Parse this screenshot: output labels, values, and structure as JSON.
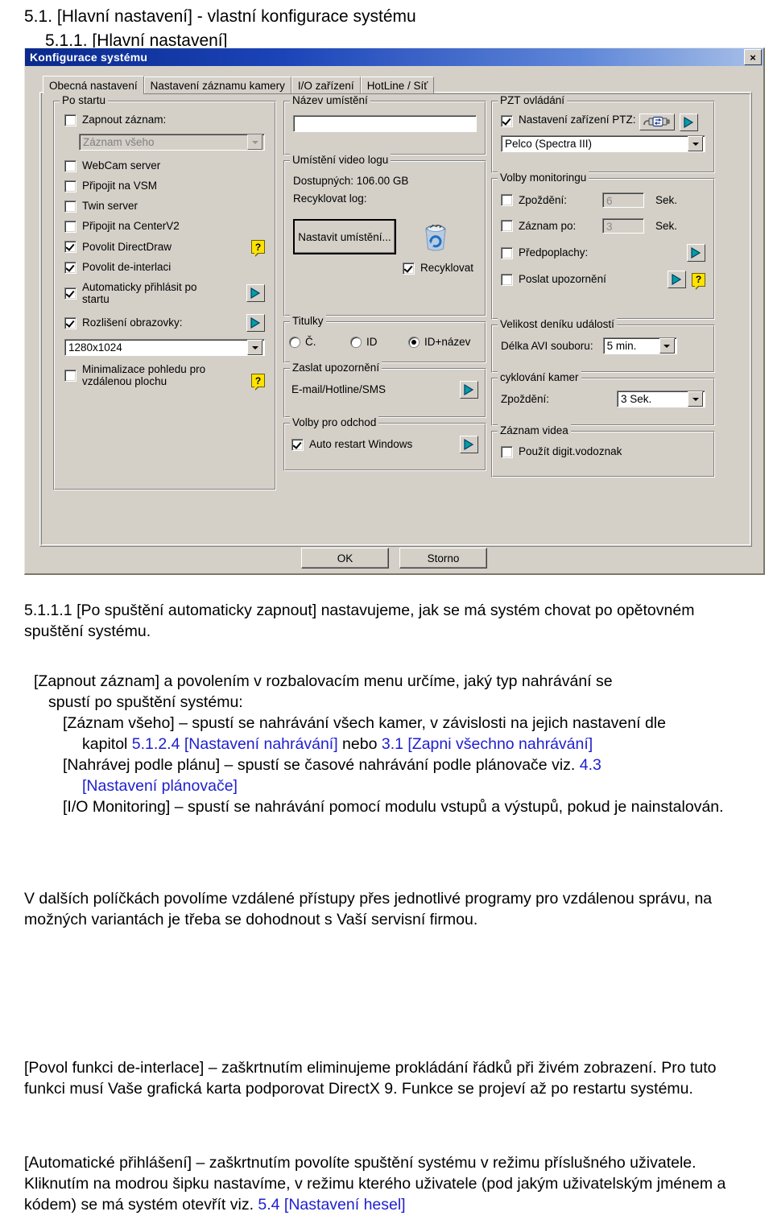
{
  "document": {
    "heading1": "5.1. [Hlavní nastavení] - vlastní konfigurace systému",
    "heading2": "5.1.1. [Hlavní nastavení]"
  },
  "dialog": {
    "title": "Konfigurace systému",
    "close_icon": "×",
    "tabs": [
      {
        "label": "Obecná nastavení",
        "active": true
      },
      {
        "label": "Nastavení záznamu kamery",
        "active": false
      },
      {
        "label": "I/O zařízení",
        "active": false
      },
      {
        "label": "HotLine / Síť",
        "active": false
      }
    ],
    "groups": {
      "po_startu": {
        "title": "Po startu",
        "zapnout_zaznam": "Zapnout záznam:",
        "zaznam_combo_value": "Záznam všeho",
        "webcam": "WebCam server",
        "vsm": "Připojit na VSM",
        "twin": "Twin server",
        "centerv2": "Připojit na CenterV2",
        "directdraw": "Povolit DirectDraw",
        "deinterlace": "Povolit de-interlaci",
        "autologin": "Automaticky přihlásit po startu",
        "resolution_label": "Rozlišení obrazovky:",
        "resolution_value": "1280x1024",
        "minimize": "Minimalizace pohledu pro vzdálenou plochu",
        "help_glyph": "?"
      },
      "nazev_umisteni": {
        "title": "Název umístění",
        "value": ""
      },
      "umisteni_video_logu": {
        "title": "Umístění video logu",
        "available": "Dostupných: 106.00 GB",
        "recycle_log": "Recyklovat log:",
        "set_location_button": "Nastavit umístění...",
        "recycle_checkbox": "Recyklovat",
        "bin_icon": "recycle-bin-icon"
      },
      "titulky": {
        "title": "Titulky",
        "options": [
          "Č.",
          "ID",
          "ID+název"
        ],
        "selected": "ID+název"
      },
      "zaslat_upozorneni": {
        "title": "Zaslat upozornění",
        "label": "E-mail/Hotline/SMS"
      },
      "volby_pro_odchod": {
        "title": "Volby pro odchod",
        "auto_restart": "Auto restart Windows"
      },
      "pzt_ovladani": {
        "title": "PZT ovládání",
        "device_label": "Nastavení zařízení PTZ:",
        "device_value": "Pelco (Spectra III)"
      },
      "volby_monitoringu": {
        "title": "Volby monitoringu",
        "zpozdeni_label": "Zpoždění:",
        "zpozdeni_value": "6",
        "zpozdeni_unit": "Sek.",
        "zaznam_po_label": "Záznam po:",
        "zaznam_po_value": "3",
        "zaznam_po_unit": "Sek.",
        "predpoplachy": "Předpoplachy:",
        "poslat_upozorneni": "Poslat upozornění"
      },
      "velikost_deniku": {
        "title": "Velikost deníku událostí",
        "avi_label": "Délka AVI souboru:",
        "avi_value": "5 min."
      },
      "cyklovani_kamer": {
        "title": "cyklování kamer",
        "zpozdeni_label": "Zpoždění:",
        "zpozdeni_value": "3 Sek."
      },
      "zaznam_videa": {
        "title": "Záznam videa",
        "watermark": "Použít digit.vodoznak"
      }
    },
    "buttons": {
      "ok": "OK",
      "cancel": "Storno"
    }
  },
  "text": {
    "para1_num": "5.1.1.1",
    "para1": "[Po spuštění automaticky zapnout] nastavujeme, jak se má systém chovat po opětovném spuštění systému.",
    "para2_line1": "[Zapnout záznam] a povolením v rozbalovacím menu určíme, jaký typ nahrávání se",
    "para2_line2": "spustí po spuštění systému:",
    "para2_line3a": "[Záznam všeho] – spustí se nahrávání všech kamer, v závislosti na jejich nastavení dle",
    "para2_line3b_pre": "kapitol ",
    "para2_link1": "5.1.2.4 [Nastavení nahrávání]",
    "para2_line3b_mid": " nebo ",
    "para2_link2": "3.1 [Zapni všechno nahrávání]",
    "para2_line4_pre": "[Nahrávej podle plánu] – spustí se časové nahrávání podle plánovače viz. ",
    "para2_link3": "4.3",
    "para2_link4": "[Nastavení plánovače]",
    "para2_line5": "[I/O Monitoring] – spustí se nahrávání pomocí modulu vstupů a výstupů, pokud je nainstalován.",
    "para3": "V dalších políčkách povolíme vzdálené přístupy přes jednotlivé programy pro vzdálenou správu, na možných variantách je třeba se dohodnout s Vaší servisní firmou.",
    "para4": "[Povol funkci de-interlace] – zaškrtnutím eliminujeme prokládání řádků při živém zobrazení. Pro tuto funkci musí Vaše grafická karta podporovat DirectX 9. Funkce se projeví až po restartu systému.",
    "para5_pre": "[Automatické přihlášení] – zaškrtnutím povolíte spuštění systému v režimu příslušného uživatele. Kliknutím na modrou šipku nastavíme, v režimu kterého uživatele (pod jakým uživatelským jménem a kódem) se má systém otevřít viz. ",
    "para5_link": "5.4 [Nastavení hesel]"
  },
  "colors": {
    "dialog_face": "#d4d0c8",
    "title_bar": "#0a2a8c",
    "link_blue": "#2020d0",
    "help_yellow": "#ffe200",
    "arrow_teal": "#008b8b"
  }
}
